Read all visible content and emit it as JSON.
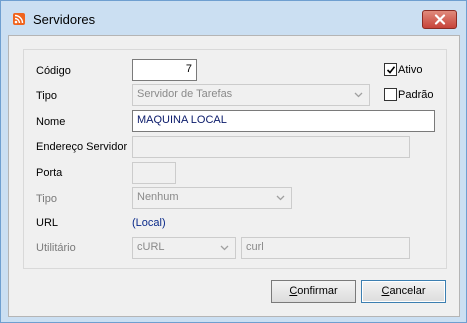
{
  "window": {
    "title": "Servidores"
  },
  "form": {
    "codigo": {
      "label": "Código",
      "value": "7"
    },
    "ativo": {
      "label": "Ativo",
      "checked": true
    },
    "tipo": {
      "label": "Tipo",
      "value": "Servidor de Tarefas"
    },
    "padrao": {
      "label": "Padrão",
      "checked": false
    },
    "nome": {
      "label": "Nome",
      "value": "MAQUINA LOCAL"
    },
    "endereco": {
      "label": "Endereço Servidor",
      "value": ""
    },
    "porta": {
      "label": "Porta",
      "value": ""
    },
    "tipo2": {
      "label": "Tipo",
      "value": "Nenhum"
    },
    "url": {
      "label": "URL",
      "value": "(Local)"
    },
    "utilitario": {
      "label": "Utilitário",
      "select_value": "cURL",
      "text_value": "curl"
    }
  },
  "buttons": {
    "confirm": {
      "accel": "C",
      "rest": "onfirmar"
    },
    "cancel": {
      "accel": "C",
      "rest": "ancelar"
    }
  },
  "icons": {
    "app": "rss-icon",
    "close": "close-icon",
    "check": "check-icon",
    "dropdown": "chevron-down-icon"
  }
}
